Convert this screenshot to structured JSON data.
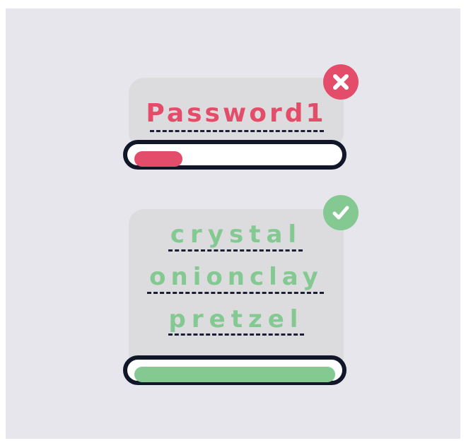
{
  "weak": {
    "password": "Password1",
    "strength_fraction": 0.24,
    "color": "#e44d6a"
  },
  "strong": {
    "words": [
      "crystal",
      "onionclay",
      "pretzel"
    ],
    "strength_fraction": 1.0,
    "color": "#84c992"
  },
  "colors": {
    "background": "#e7e6ec",
    "card": "#dcdcdf",
    "outline": "#111629"
  },
  "icons": {
    "weak_badge": "close-icon",
    "strong_badge": "check-icon"
  }
}
